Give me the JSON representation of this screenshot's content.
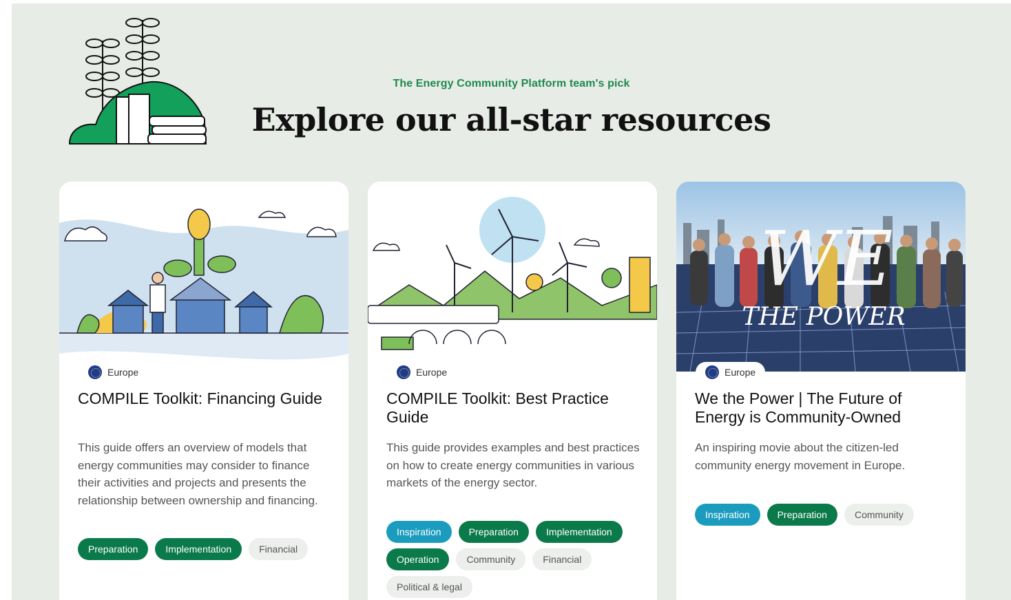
{
  "hero": {
    "eyebrow": "The Energy Community Platform team's pick",
    "title": "Explore our all-star resources"
  },
  "colors": {
    "page_bg": "#e8ece6",
    "accent_green": "#1c8a4e",
    "tag_green": "#0b7a4a",
    "tag_blue": "#1b9cbf",
    "tag_grey": "#ecefeb"
  },
  "cards": [
    {
      "region": "Europe",
      "title": "COMPILE Toolkit: Financing Guide",
      "description": "This guide offers an overview of models that energy communities may consider to finance their activities and projects and presents the relationship between ownership and financing.",
      "tags": [
        {
          "label": "Preparation",
          "style": "green"
        },
        {
          "label": "Implementation",
          "style": "green"
        },
        {
          "label": "Financial",
          "style": "grey"
        }
      ]
    },
    {
      "region": "Europe",
      "title": "COMPILE Toolkit: Best Practice Guide",
      "description": "This guide provides examples and best practices on how to create energy communities in various markets of the energy sector.",
      "tags": [
        {
          "label": "Inspiration",
          "style": "blue"
        },
        {
          "label": "Preparation",
          "style": "green"
        },
        {
          "label": "Implementation",
          "style": "green"
        },
        {
          "label": "Operation",
          "style": "green"
        },
        {
          "label": "Community",
          "style": "grey"
        },
        {
          "label": "Financial",
          "style": "grey"
        },
        {
          "label": "Political & legal",
          "style": "grey"
        }
      ]
    },
    {
      "region": "Europe",
      "title": "We the Power | The Future of Energy is Community-Owned",
      "description": "An inspiring movie about the citizen-led community energy movement in Europe.",
      "image_text": {
        "big": "WE",
        "sub": "THE POWER"
      },
      "tags": [
        {
          "label": "Inspiration",
          "style": "blue"
        },
        {
          "label": "Preparation",
          "style": "green"
        },
        {
          "label": "Community",
          "style": "grey"
        }
      ]
    }
  ]
}
